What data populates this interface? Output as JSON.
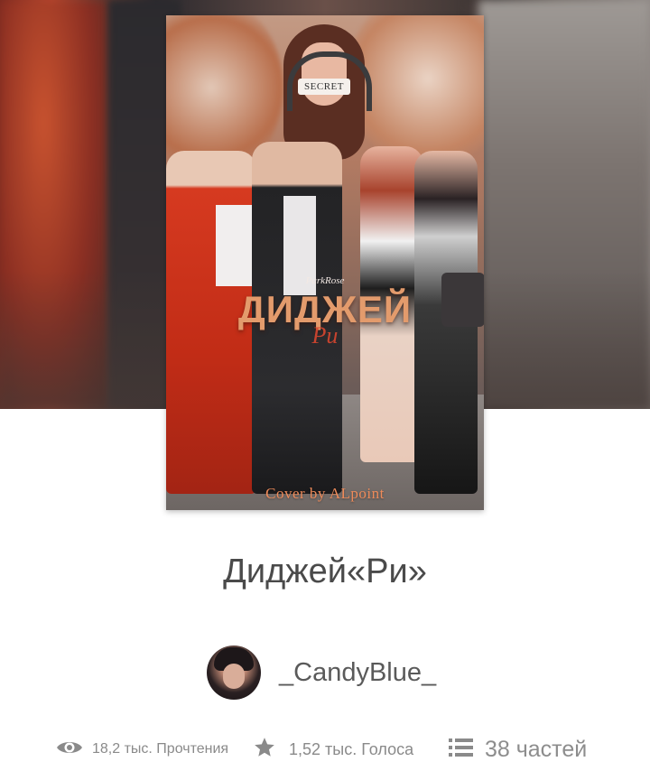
{
  "cover": {
    "blindfold_text": "SECRET",
    "author_tag": "ParkRose",
    "title_text": "ДИДЖЕЙ",
    "subtitle_text": "Ри",
    "credit_text": "Cover by ALpoint"
  },
  "story": {
    "title": "Диджей«Ри»",
    "author": "_CandyBlue_"
  },
  "stats": {
    "reads": "18,2 тыс. Прочтения",
    "votes": "1,52 тыс. Голоса",
    "parts": "38 частей"
  },
  "icons": {
    "reads": "eye-icon",
    "votes": "star-icon",
    "parts": "list-icon"
  },
  "colors": {
    "text_primary": "#4a4a4a",
    "text_muted": "#8a8a8a",
    "background": "#ffffff"
  }
}
